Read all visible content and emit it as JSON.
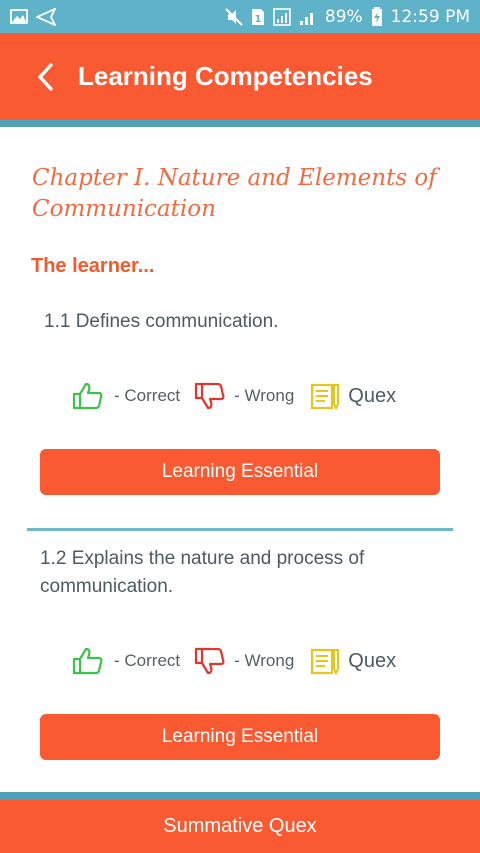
{
  "status_bar": {
    "battery": "89%",
    "time": "12:59 PM",
    "sim_label": "1"
  },
  "header": {
    "title": "Learning Competencies"
  },
  "chapter": {
    "title": "Chapter I. Nature and Elements of Communication",
    "learner_label": "The learner..."
  },
  "competencies": [
    {
      "text": "1.1 Defines communication.",
      "correct_label": "- Correct",
      "wrong_label": "- Wrong",
      "quex_label": "Quex",
      "button_label": "Learning Essential"
    },
    {
      "text": "1.2 Explains the nature and process of communication.",
      "correct_label": "- Correct",
      "wrong_label": "- Wrong",
      "quex_label": "Quex",
      "button_label": "Learning Essential"
    }
  ],
  "footer": {
    "button_label": "Summative Quex"
  },
  "colors": {
    "primary": "#fa5a32",
    "accent": "#4fa0b8",
    "correct": "#3cc24a",
    "wrong": "#e0342c",
    "quex": "#e8c51a"
  }
}
